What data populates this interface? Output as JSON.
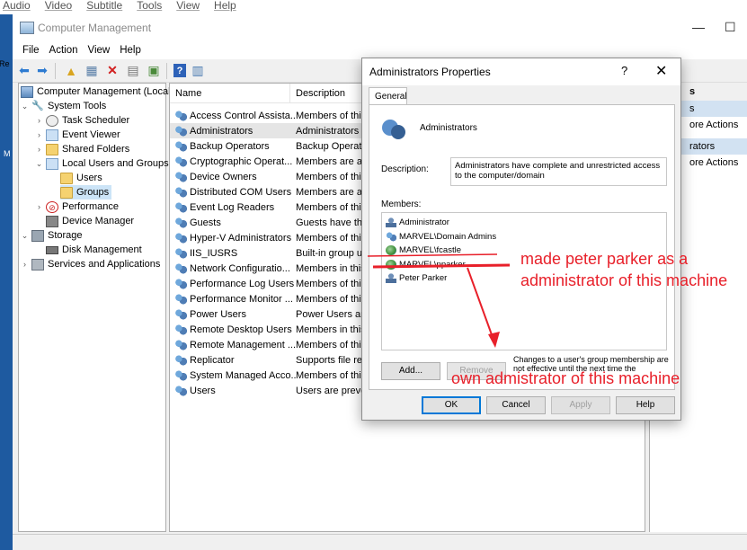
{
  "player_menu": [
    "Audio",
    "Video",
    "Subtitle",
    "Tools",
    "View",
    "Help"
  ],
  "desktop": {
    "left_text": "Re",
    "left_text2": "M"
  },
  "window": {
    "title": "Computer Management",
    "controls": {
      "minimize": "—",
      "maximize": "☐"
    },
    "menu": [
      "File",
      "Action",
      "View",
      "Help"
    ]
  },
  "tree": {
    "root": "Computer Management (Local)",
    "system_tools": "System Tools",
    "task_scheduler": "Task Scheduler",
    "event_viewer": "Event Viewer",
    "shared_folders": "Shared Folders",
    "local_users_groups": "Local Users and Groups",
    "users": "Users",
    "groups": "Groups",
    "performance": "Performance",
    "device_manager": "Device Manager",
    "storage": "Storage",
    "disk_management": "Disk Management",
    "services_apps": "Services and Applications"
  },
  "list": {
    "columns": {
      "name": "Name",
      "description": "Description"
    },
    "rows": [
      {
        "name": "Access Control Assista...",
        "desc": "Members of this"
      },
      {
        "name": "Administrators",
        "desc": "Administrators h"
      },
      {
        "name": "Backup Operators",
        "desc": "Backup Operato"
      },
      {
        "name": "Cryptographic Operat...",
        "desc": "Members are au"
      },
      {
        "name": "Device Owners",
        "desc": "Members of this"
      },
      {
        "name": "Distributed COM Users",
        "desc": "Members are allo"
      },
      {
        "name": "Event Log Readers",
        "desc": "Members of this"
      },
      {
        "name": "Guests",
        "desc": "Guests have the"
      },
      {
        "name": "Hyper-V Administrators",
        "desc": "Members of this"
      },
      {
        "name": "IIS_IUSRS",
        "desc": "Built-in group u"
      },
      {
        "name": "Network Configuratio...",
        "desc": "Members in this"
      },
      {
        "name": "Performance Log Users",
        "desc": "Members of this"
      },
      {
        "name": "Performance Monitor ...",
        "desc": "Members of this"
      },
      {
        "name": "Power Users",
        "desc": "Power Users are"
      },
      {
        "name": "Remote Desktop Users",
        "desc": "Members in this"
      },
      {
        "name": "Remote Management ...",
        "desc": "Members of this"
      },
      {
        "name": "Replicator",
        "desc": "Supports file rep"
      },
      {
        "name": "System Managed Acco...",
        "desc": "Members of this"
      },
      {
        "name": "Users",
        "desc": "Users are preven"
      }
    ]
  },
  "actions": {
    "head": "s",
    "sub1": "s",
    "item1": "ore Actions",
    "sub2": "rators",
    "item2": "ore Actions"
  },
  "dialog": {
    "title": "Administrators Properties",
    "help": "?",
    "close": "✕",
    "tab": "General",
    "group_name": "Administrators",
    "description_label": "Description:",
    "description": "Administrators have complete and unrestricted access to the computer/domain",
    "members_label": "Members:",
    "members": [
      {
        "name": "Administrator",
        "kind": "user"
      },
      {
        "name": "MARVEL\\Domain Admins",
        "kind": "group"
      },
      {
        "name": "MARVEL\\fcastle",
        "kind": "domain-user"
      },
      {
        "name": "MARVEL\\pparker",
        "kind": "domain-user"
      },
      {
        "name": "Peter Parker",
        "kind": "user"
      }
    ],
    "add": "Add...",
    "remove": "Remove",
    "note": "Changes to a user's group membership are not effective until the next time the",
    "ok": "OK",
    "cancel": "Cancel",
    "apply": "Apply",
    "help_btn": "Help"
  },
  "annotations": {
    "text1": "made peter parker as a administrator of this machine",
    "text2": "own admistrator of this machine",
    "color": "#e8202a"
  }
}
